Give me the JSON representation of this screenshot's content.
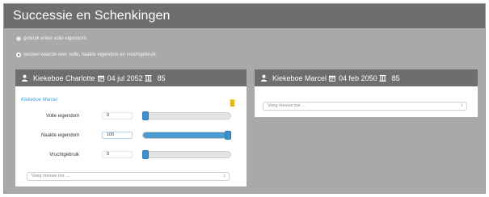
{
  "app": {
    "title": "Successie en Schenkingen"
  },
  "options": [
    {
      "label": "gebruik enkel volle eigendom",
      "selected": false
    },
    {
      "label": "verdeel waarde over volle, naakte eigendom en vruchtgebruik",
      "selected": true
    }
  ],
  "cards": [
    {
      "name": "Kiekeboe Charlotte",
      "date": "04 jul 2052",
      "number": "85",
      "beneficiary": {
        "name": "Kiekeboe Marcel",
        "rows": [
          {
            "label": "Volle eigendom",
            "value": "0",
            "fraction": 0.0
          },
          {
            "label": "Naakte eigendom",
            "value": "100",
            "fraction": 1.0
          },
          {
            "label": "Vruchtgebruik",
            "value": "0",
            "fraction": 0.0
          }
        ]
      },
      "select_placeholder": "Voeg nieuwe toe ..."
    },
    {
      "name": "Kiekeboe Marcel",
      "date": "04 feb 2050",
      "number": "85",
      "select_placeholder": "Voeg nieuwe toe ..."
    }
  ],
  "colors": {
    "header": "#6e6e6e",
    "background": "#a9a9a9",
    "accent": "#4a9cd0",
    "trash": "#f0b400"
  },
  "icons": [
    "user-icon",
    "calendar-icon",
    "tombstone-icon",
    "trash-icon",
    "select-caret-icon"
  ]
}
